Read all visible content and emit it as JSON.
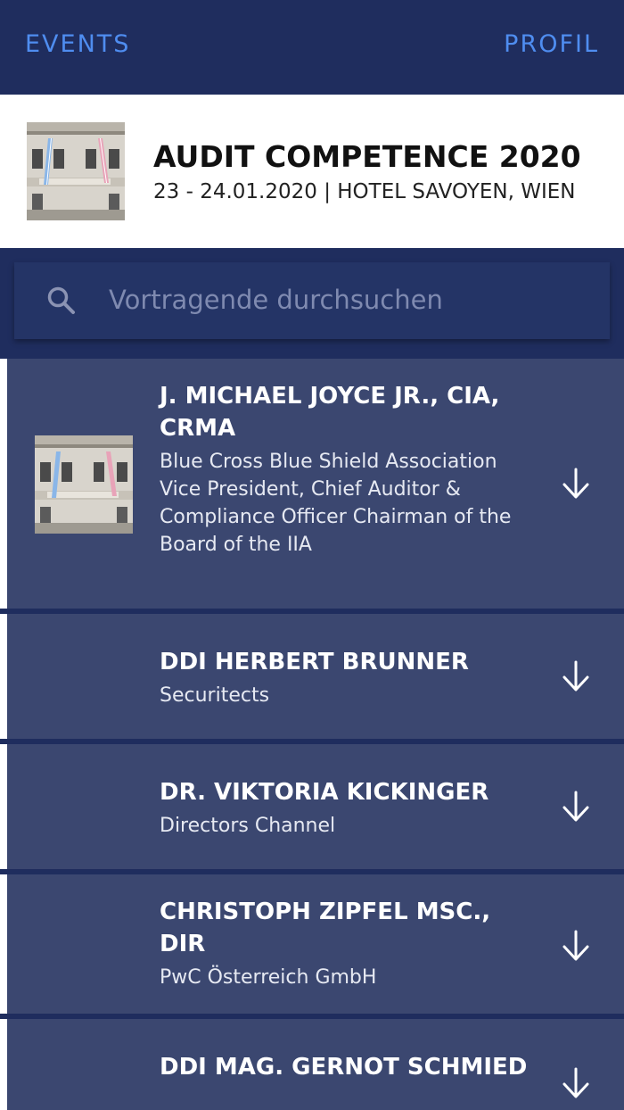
{
  "nav": {
    "left_label": "EVENTS",
    "right_label": "PROFIL"
  },
  "event": {
    "title": "AUDIT COMPETENCE 2020",
    "subtitle": "23 - 24.01.2020 | HOTEL SAVOYEN, WIEN",
    "image_icon": "hotel-building-photo"
  },
  "search": {
    "placeholder": "Vortragende durchsuchen",
    "value": "",
    "icon": "search-icon"
  },
  "speakers": [
    {
      "name": "J. MICHAEL JOYCE JR., CIA, CRMA",
      "organization": "Blue Cross Blue Shield Association Vice President, Chief Auditor & Compliance Officer Chairman of the Board of the IIA",
      "has_photo": true,
      "action_icon": "arrow-down-icon"
    },
    {
      "name": "DDI HERBERT BRUNNER",
      "organization": "Securitects",
      "has_photo": false,
      "action_icon": "arrow-down-icon"
    },
    {
      "name": "DR. VIKTORIA KICKINGER",
      "organization": "Directors Channel",
      "has_photo": false,
      "action_icon": "arrow-down-icon"
    },
    {
      "name": "CHRISTOPH ZIPFEL MSC., DIR",
      "organization": "PwC Österreich GmbH",
      "has_photo": false,
      "action_icon": "arrow-down-icon"
    },
    {
      "name": "DDI MAG. GERNOT SCHMIED",
      "organization": "",
      "has_photo": false,
      "action_icon": "arrow-down-icon"
    }
  ],
  "colors": {
    "nav_background": "#1f2d5e",
    "nav_link": "#4f8df0",
    "header_background": "#ffffff",
    "search_background": "#243466",
    "item_background": "#3b4770",
    "item_accent": "#ffffff",
    "text_primary": "#ffffff"
  }
}
